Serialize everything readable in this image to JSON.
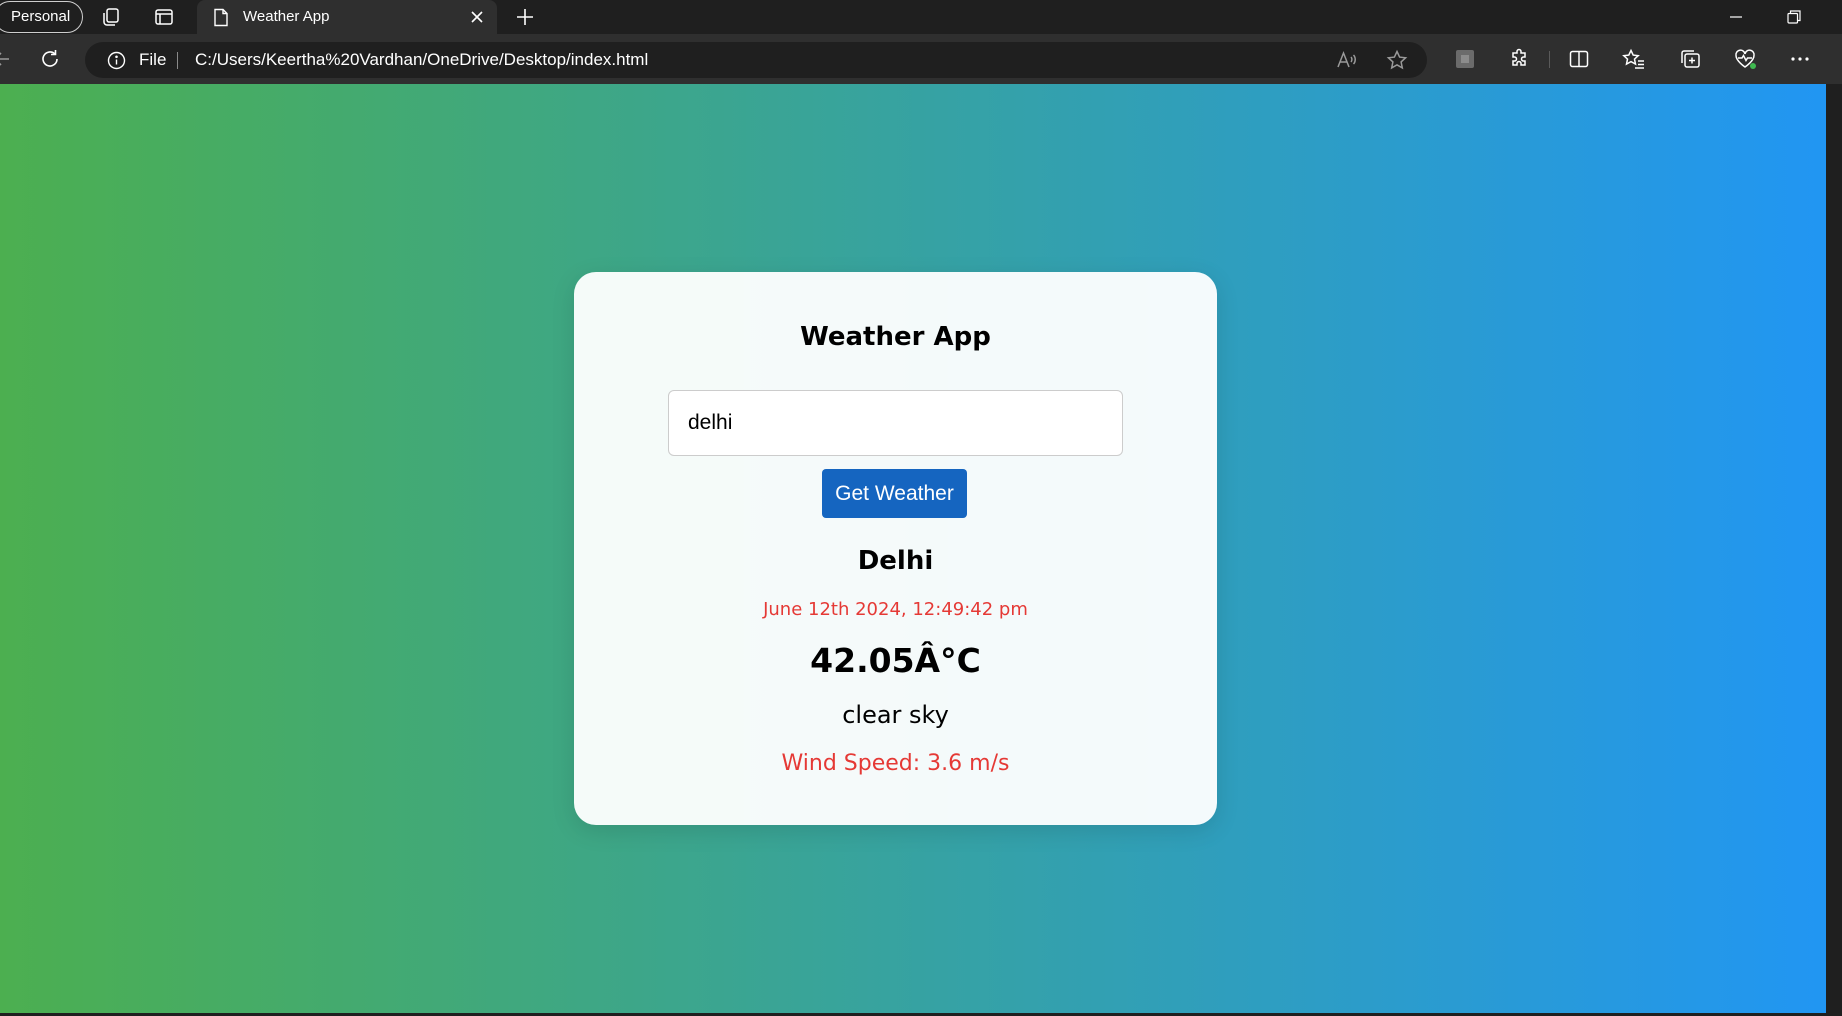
{
  "browser": {
    "profile_label": "Personal",
    "tab": {
      "title": "Weather App"
    },
    "address": {
      "scheme_label": "File",
      "url": "C:/Users/Keertha%20Vardhan/OneDrive/Desktop/index.html"
    },
    "icons": [
      "back-arrow-icon",
      "refresh-icon",
      "info-icon",
      "read-aloud-icon",
      "favorite-star-icon",
      "extension-square-icon",
      "extensions-puzzle-icon",
      "split-screen-icon",
      "favorites-icon",
      "collections-icon",
      "browser-essentials-icon",
      "more-menu-icon"
    ]
  },
  "app": {
    "title": "Weather App",
    "search": {
      "value": "delhi",
      "placeholder": ""
    },
    "button_label": "Get Weather",
    "result": {
      "city": "Delhi",
      "datetime": "June 12th 2024, 12:49:42 pm",
      "temperature": "42.05Â°C",
      "description": "clear sky",
      "wind": "Wind Speed: 3.6 m/s"
    }
  },
  "colors": {
    "gradient_start": "#4caf50",
    "gradient_end": "#2196f3",
    "button_bg": "#1565c0",
    "accent_red": "#e53935"
  }
}
